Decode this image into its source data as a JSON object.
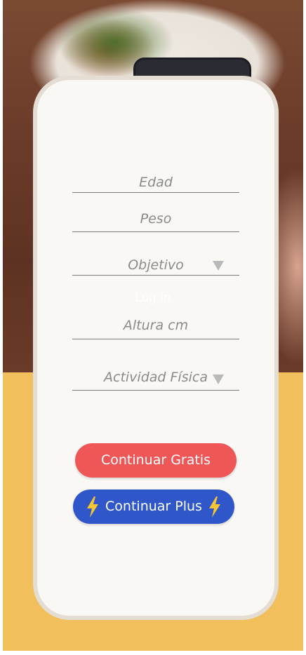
{
  "form": {
    "age_placeholder": "Edad",
    "weight_placeholder": "Peso",
    "goal_label": "Objetivo",
    "height_placeholder": "Altura cm",
    "activity_label": "Actividad Física",
    "faded_overlay_text": "Log In"
  },
  "buttons": {
    "free_label": "Continuar Gratis",
    "plus_label": "Continuar Plus"
  },
  "colors": {
    "bottom_background": "#f1bf5c",
    "free_button": "#ef5656",
    "plus_button": "#2f57c9",
    "bolt": "#f6c531"
  },
  "icons": {
    "dropdown": "triangle-down-icon",
    "plus": "lightning-bolt-icon"
  }
}
